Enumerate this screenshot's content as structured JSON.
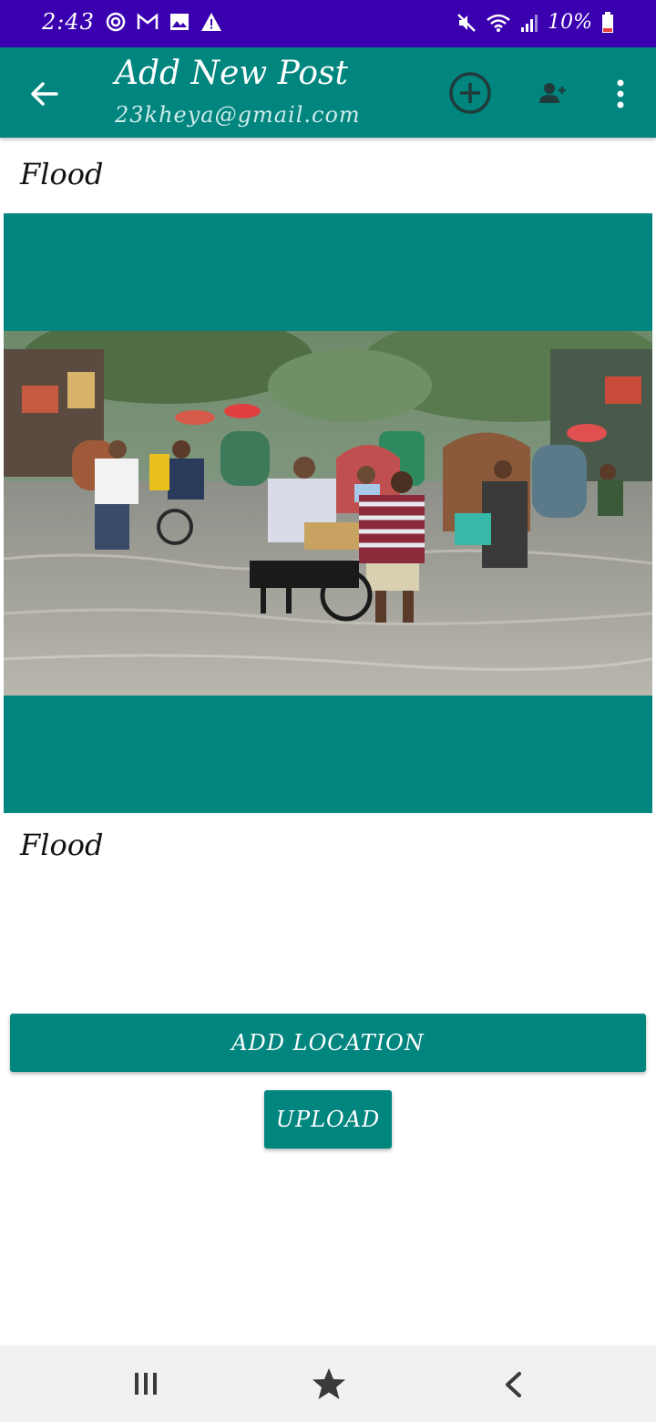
{
  "status_bar": {
    "time": "2:43",
    "battery": "10%",
    "icons": [
      "sync-icon",
      "gmail-icon",
      "gallery-icon",
      "warning-icon",
      "mute-icon",
      "wifi-icon",
      "signal-icon",
      "battery-icon"
    ]
  },
  "app_bar": {
    "title": "Add New Post",
    "subtitle": "23kheya@gmail.com",
    "icons": [
      "back-arrow-icon",
      "add-circle-icon",
      "add-user-icon",
      "more-vert-icon"
    ]
  },
  "post": {
    "title_value": "Flood",
    "description_value": "Flood",
    "image_icon": "flood-photo"
  },
  "buttons": {
    "add_location": "ADD LOCATION",
    "upload": "UPLOAD"
  },
  "nav_bar": {
    "icons": [
      "recents-icon",
      "home-icon",
      "back-icon"
    ]
  },
  "colors": {
    "status_bar": "#3a00b0",
    "primary": "#00857f",
    "nav_bar": "#f1f1f1"
  }
}
